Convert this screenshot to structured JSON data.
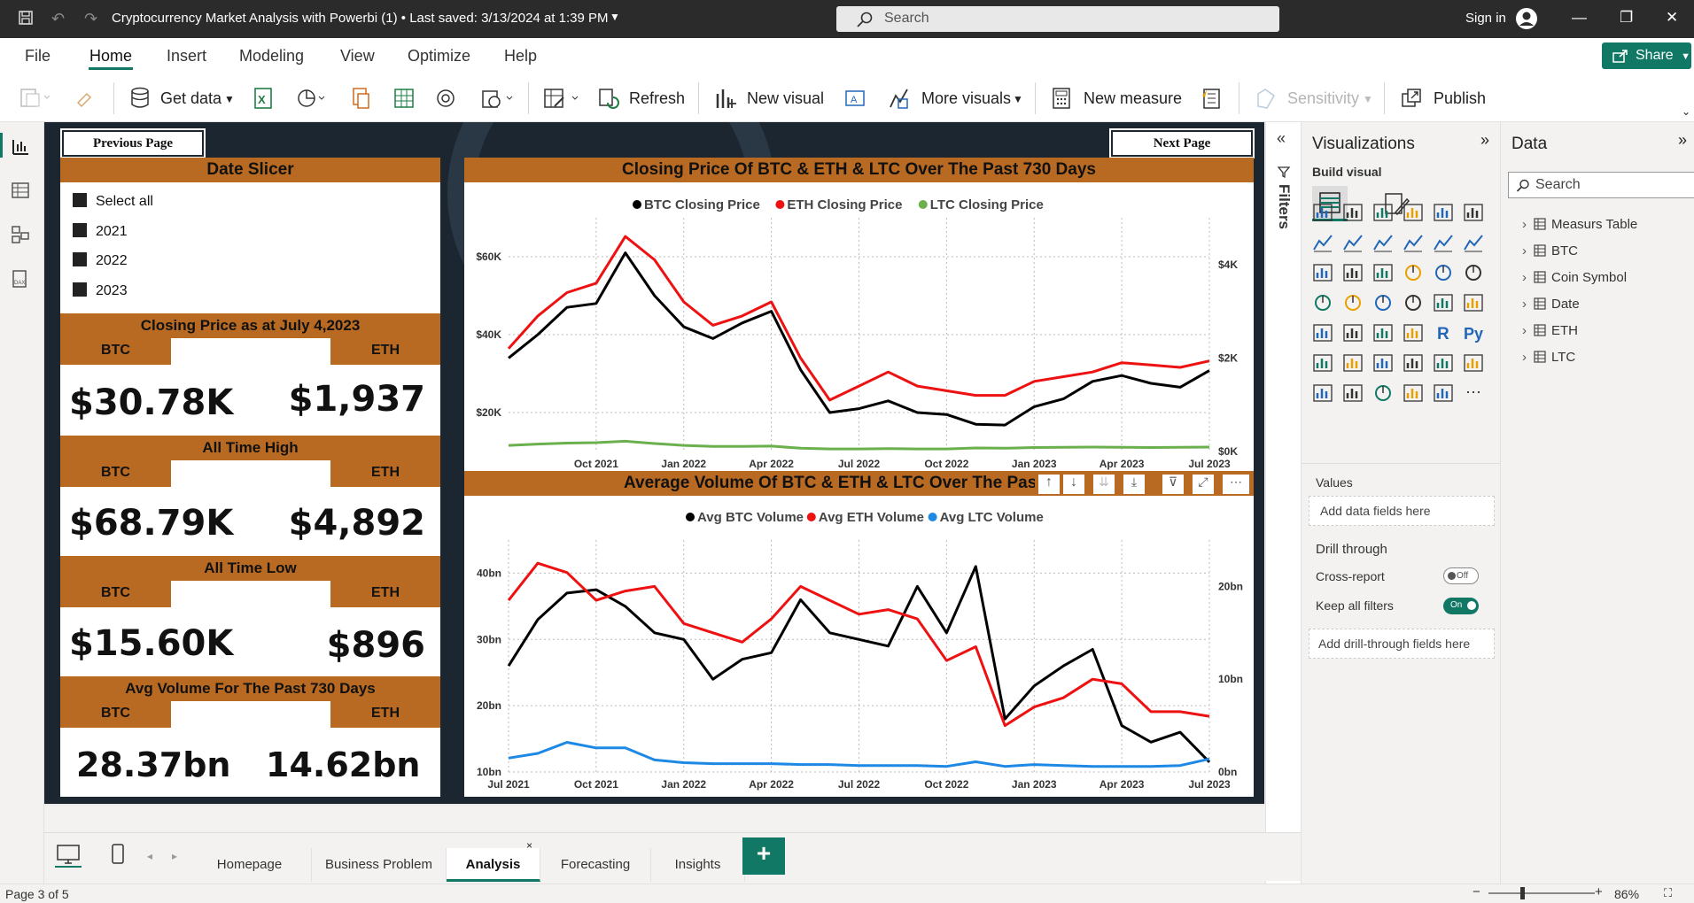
{
  "window": {
    "title": "Cryptocurrency Market Analysis with Powerbi (1) • Last saved: 3/13/2024 at 1:39 PM",
    "search_placeholder": "Search",
    "signin": "Sign in"
  },
  "menu": {
    "file": "File",
    "home": "Home",
    "insert": "Insert",
    "modeling": "Modeling",
    "view": "View",
    "optimize": "Optimize",
    "help": "Help",
    "share": "Share"
  },
  "ribbon": {
    "get_data": "Get data",
    "refresh": "Refresh",
    "new_visual": "New visual",
    "more_visuals": "More visuals",
    "new_measure": "New measure",
    "sensitivity": "Sensitivity",
    "publish": "Publish"
  },
  "report": {
    "prev_page": "Previous Page",
    "next_page": "Next Page",
    "slicer": {
      "title": "Date Slicer",
      "options": [
        "Select all",
        "2021",
        "2022",
        "2023"
      ]
    },
    "cards": [
      {
        "title": "Closing Price as at July 4,2023",
        "left_label": "BTC",
        "right_label": "ETH",
        "left_value": "$30.78K",
        "right_value": "$1,937"
      },
      {
        "title": "All Time High",
        "left_label": "BTC",
        "right_label": "ETH",
        "left_value": "$68.79K",
        "right_value": "$4,892"
      },
      {
        "title": "All Time Low",
        "left_label": "BTC",
        "right_label": "ETH",
        "left_value": "$15.60K",
        "right_value": "$896"
      },
      {
        "title": "Avg Volume For The Past 730 Days",
        "left_label": "BTC",
        "right_label": "ETH",
        "left_value": "28.37bn",
        "right_value": "14.62bn"
      }
    ]
  },
  "chart_data": [
    {
      "type": "line",
      "title": "Closing Price Of BTC & ETH & LTC Over The Past 730 Days",
      "legend": "top-center",
      "x": [
        "2021-07",
        "2021-08",
        "2021-09",
        "2021-10",
        "2021-11",
        "2021-12",
        "2022-01",
        "2022-02",
        "2022-03",
        "2022-04",
        "2022-05",
        "2022-06",
        "2022-07",
        "2022-08",
        "2022-09",
        "2022-10",
        "2022-11",
        "2022-12",
        "2023-01",
        "2023-02",
        "2023-03",
        "2023-04",
        "2023-05",
        "2023-06",
        "2023-07"
      ],
      "x_ticks": [
        "Oct 2021",
        "Jan 2022",
        "Apr 2022",
        "Jul 2022",
        "Oct 2022",
        "Jan 2023",
        "Apr 2023",
        "Jul 2023"
      ],
      "y_left_ticks": [
        "$20K",
        "$40K",
        "$60K"
      ],
      "y_right_ticks": [
        "$0K",
        "$2K",
        "$4K"
      ],
      "y_left_lim": [
        10000,
        70000
      ],
      "y_right_lim": [
        0,
        5000
      ],
      "series": [
        {
          "name": "BTC Closing Price",
          "axis": "left",
          "color": "#000000",
          "values": [
            34000,
            40000,
            47000,
            48000,
            61000,
            50000,
            42000,
            39000,
            43000,
            46000,
            31000,
            20000,
            21000,
            23000,
            20000,
            19500,
            17000,
            16800,
            21500,
            23500,
            28000,
            29500,
            27500,
            26500,
            30780
          ]
        },
        {
          "name": "ETH Closing Price",
          "axis": "right",
          "color": "#ee1111",
          "values": [
            2200,
            2900,
            3400,
            3600,
            4600,
            4100,
            3200,
            2700,
            2900,
            3200,
            2000,
            1100,
            1400,
            1700,
            1400,
            1300,
            1200,
            1200,
            1500,
            1600,
            1700,
            1900,
            1850,
            1800,
            1937
          ]
        },
        {
          "name": "LTC Closing Price",
          "axis": "right",
          "color": "#6ab04c",
          "values": [
            130,
            160,
            180,
            190,
            220,
            170,
            130,
            110,
            110,
            115,
            70,
            55,
            55,
            60,
            55,
            55,
            75,
            70,
            85,
            90,
            95,
            90,
            85,
            90,
            95
          ]
        }
      ]
    },
    {
      "type": "line",
      "title": "Average Volume Of BTC & ETH & LTC Over The Past 73",
      "legend": "top-center",
      "x": [
        "2021-07",
        "2021-08",
        "2021-09",
        "2021-10",
        "2021-11",
        "2021-12",
        "2022-01",
        "2022-02",
        "2022-03",
        "2022-04",
        "2022-05",
        "2022-06",
        "2022-07",
        "2022-08",
        "2022-09",
        "2022-10",
        "2022-11",
        "2022-12",
        "2023-01",
        "2023-02",
        "2023-03",
        "2023-04",
        "2023-05",
        "2023-06",
        "2023-07"
      ],
      "x_ticks": [
        "Jul 2021",
        "Oct 2021",
        "Jan 2022",
        "Apr 2022",
        "Jul 2022",
        "Oct 2022",
        "Jan 2023",
        "Apr 2023",
        "Jul 2023"
      ],
      "y_left_ticks": [
        "10bn",
        "20bn",
        "30bn",
        "40bn"
      ],
      "y_right_ticks": [
        "0bn",
        "10bn",
        "20bn"
      ],
      "y_left_lim": [
        10,
        45
      ],
      "y_right_lim": [
        0,
        25
      ],
      "series": [
        {
          "name": "Avg BTC Volume",
          "axis": "left",
          "color": "#000000",
          "values": [
            26,
            33,
            37,
            37.5,
            35,
            31,
            30,
            24,
            27,
            28,
            36,
            31,
            30,
            29,
            38,
            31,
            41,
            18,
            23,
            26,
            28.5,
            17,
            14.5,
            16,
            11.5
          ]
        },
        {
          "name": "Avg ETH Volume",
          "axis": "right",
          "color": "#ee1111",
          "values": [
            18.5,
            22.5,
            21.5,
            18.5,
            19.5,
            20,
            16,
            15,
            14,
            16.5,
            20,
            18.5,
            17,
            17.5,
            16.5,
            12,
            13.5,
            5,
            7,
            8,
            10,
            9.5,
            6.5,
            6.5,
            6
          ]
        },
        {
          "name": "Avg LTC Volume",
          "axis": "right",
          "color": "#1e88e5",
          "values": [
            1.5,
            2,
            3.2,
            2.6,
            2.6,
            1.3,
            1,
            0.9,
            0.9,
            0.9,
            0.8,
            0.8,
            0.7,
            0.7,
            0.7,
            0.6,
            1.1,
            0.6,
            0.8,
            0.7,
            0.6,
            0.6,
            0.6,
            0.7,
            1.4
          ]
        }
      ]
    }
  ],
  "panes": {
    "filters": "Filters",
    "visualizations": "Visualizations",
    "build_visual": "Build visual",
    "values": "Values",
    "add_data_fields": "Add data fields here",
    "drill_through": "Drill through",
    "cross_report": "Cross-report",
    "cross_report_state": "Off",
    "keep_all_filters": "Keep all filters",
    "keep_all_filters_state": "On",
    "add_drill_fields": "Add drill-through fields here",
    "data": "Data",
    "data_search": "Search",
    "tables": [
      "Measurs Table",
      "BTC",
      "Coin Symbol",
      "Date",
      "ETH",
      "LTC"
    ]
  },
  "tabs": [
    "Homepage",
    "Business Problem",
    "Analysis",
    "Forecasting",
    "Insights"
  ],
  "active_tab": "Analysis",
  "status": {
    "page": "Page 3 of 5",
    "zoom": "86%"
  },
  "colors": {
    "accent": "#117865",
    "orange": "#b86a22",
    "report_bg": "#1c2631"
  }
}
